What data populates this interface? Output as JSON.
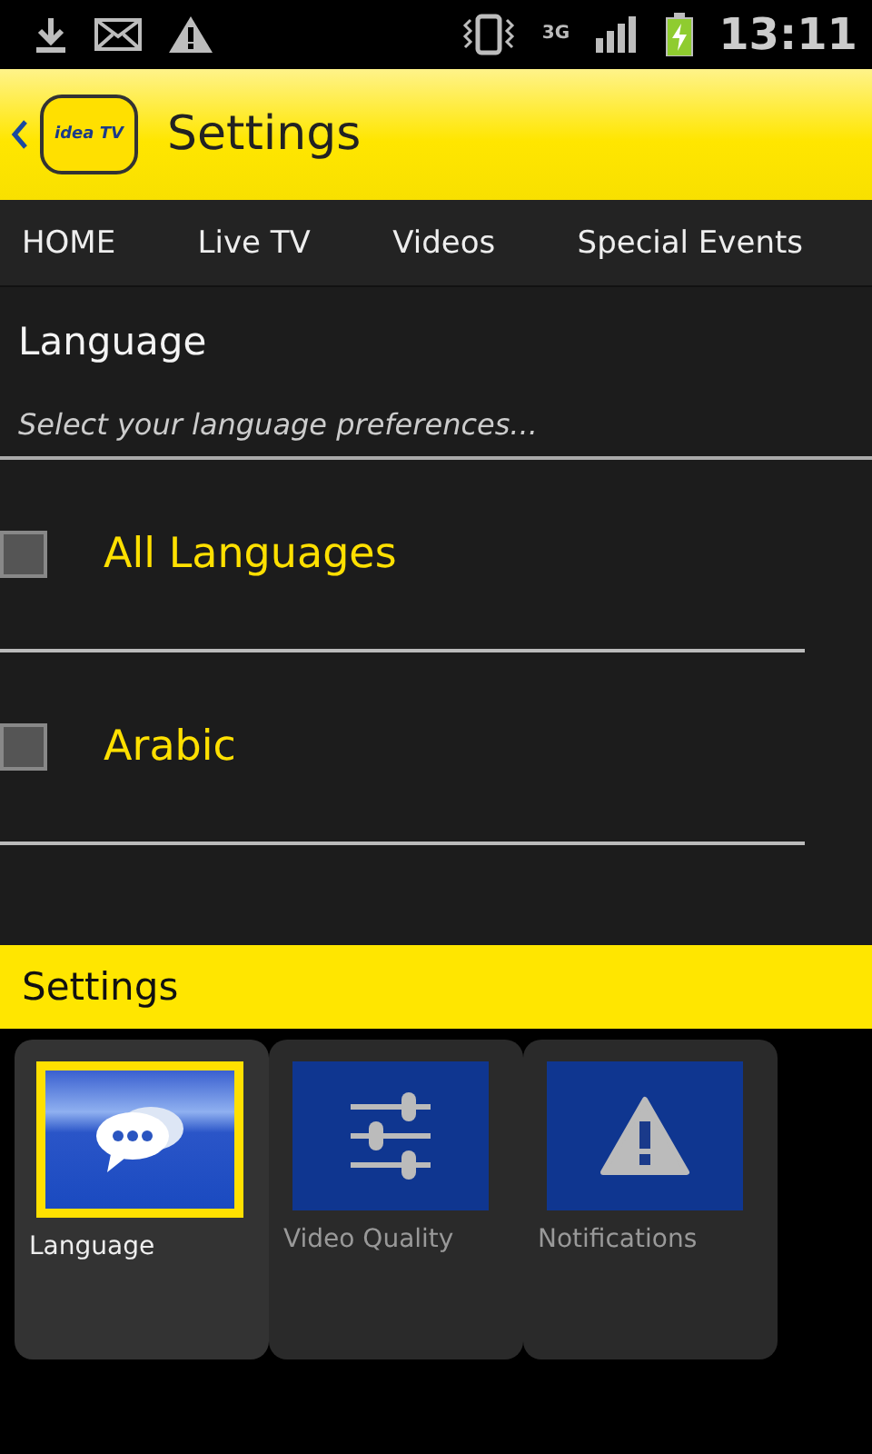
{
  "status_bar": {
    "network": "3G",
    "time": "13:11"
  },
  "header": {
    "logo_text": "idea TV",
    "title": "Settings"
  },
  "tabs": [
    "HOME",
    "Live TV",
    "Videos",
    "Special Events"
  ],
  "section": {
    "title": "Language",
    "subtitle": "Select your language preferences..."
  },
  "languages": [
    {
      "label": "All Languages",
      "checked": false
    },
    {
      "label": "Arabic",
      "checked": false
    }
  ],
  "menu": {
    "title": "Settings",
    "items": [
      {
        "kind": "chat",
        "label": "Language",
        "selected": true
      },
      {
        "kind": "sliders",
        "label": "Video Quality",
        "selected": false
      },
      {
        "kind": "warning",
        "label": "Notifications",
        "selected": false
      }
    ]
  }
}
